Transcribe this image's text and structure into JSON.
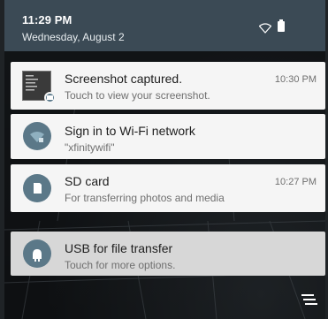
{
  "status": {
    "time": "11:29 PM",
    "date": "Wednesday, August 2"
  },
  "notifications": [
    {
      "title": "Screenshot captured.",
      "subtitle": "Touch to view your screenshot.",
      "time": "10:30 PM",
      "icon": "screenshot-thumbnail"
    },
    {
      "title": "Sign in to Wi-Fi network",
      "subtitle": "\"xfinitywifi\"",
      "time": "",
      "icon": "wifi-signin-icon"
    },
    {
      "title": "SD card",
      "subtitle": "For transferring photos and media",
      "time": "10:27 PM",
      "icon": "sd-card-icon"
    },
    {
      "title": "USB for file transfer",
      "subtitle": "Touch for more options.",
      "time": "",
      "icon": "android-usb-icon"
    }
  ],
  "colors": {
    "header": "#3b4a55",
    "card": "#f5f5f5",
    "usb_card": "#d7d7d7",
    "icon_circle": "#5b7888"
  },
  "icons": [
    "wifi-icon",
    "battery-icon",
    "clear-all-icon"
  ]
}
